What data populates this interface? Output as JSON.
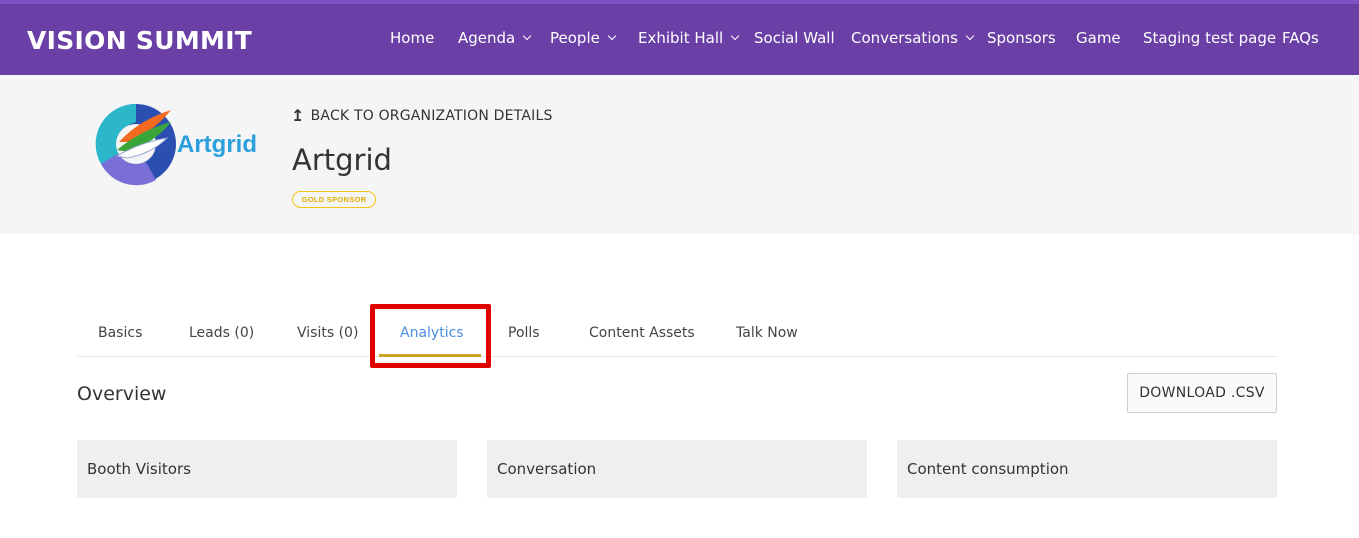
{
  "brand": {
    "name": "VISION SUMMIT"
  },
  "nav": [
    {
      "label": "Home",
      "dropdown": false
    },
    {
      "label": "Agenda",
      "dropdown": true
    },
    {
      "label": "People",
      "dropdown": true
    },
    {
      "label": "Exhibit Hall",
      "dropdown": true
    },
    {
      "label": "Social Wall",
      "dropdown": false
    },
    {
      "label": "Conversations",
      "dropdown": true
    },
    {
      "label": "Sponsors",
      "dropdown": false
    },
    {
      "label": "Game",
      "dropdown": false
    },
    {
      "label": "Staging test page",
      "dropdown": false
    },
    {
      "label": "FAQs",
      "dropdown": false
    }
  ],
  "org": {
    "back_label": "BACK TO ORGANIZATION DETAILS",
    "logo_text": "Artgrid",
    "name": "Artgrid",
    "badge": "GOLD SPONSOR"
  },
  "tabs": [
    {
      "label": "Basics",
      "active": false
    },
    {
      "label": "Leads (0)",
      "active": false
    },
    {
      "label": "Visits (0)",
      "active": false
    },
    {
      "label": "Analytics",
      "active": true
    },
    {
      "label": "Polls",
      "active": false
    },
    {
      "label": "Content Assets",
      "active": false
    },
    {
      "label": "Talk Now",
      "active": false
    }
  ],
  "overview": {
    "title": "Overview",
    "download_label": "DOWNLOAD .CSV",
    "cards": [
      {
        "title": "Booth Visitors"
      },
      {
        "title": "Conversation"
      },
      {
        "title": "Content consumption"
      }
    ]
  },
  "colors": {
    "nav_bg": "#6a3fa6",
    "header_bg": "#f5f5f5",
    "active_tab": "#4a8fe0",
    "tab_underline": "#c9a227",
    "badge": "#f0c419",
    "highlight": "#e00000",
    "card_bg": "#efefef"
  }
}
